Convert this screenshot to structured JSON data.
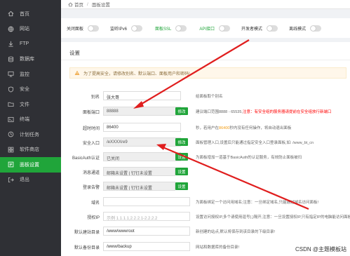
{
  "sidebar": {
    "items": [
      {
        "label": "首页",
        "icon": "home-icon"
      },
      {
        "label": "网站",
        "icon": "globe-icon"
      },
      {
        "label": "FTP",
        "icon": "ftp-icon"
      },
      {
        "label": "数据库",
        "icon": "database-icon"
      },
      {
        "label": "监控",
        "icon": "monitor-icon"
      },
      {
        "label": "安全",
        "icon": "shield-icon"
      },
      {
        "label": "文件",
        "icon": "folder-icon"
      },
      {
        "label": "终端",
        "icon": "terminal-icon"
      },
      {
        "label": "计划任务",
        "icon": "clock-icon"
      },
      {
        "label": "软件商店",
        "icon": "store-icon"
      },
      {
        "label": "面板设置",
        "icon": "settings-icon",
        "active": true
      },
      {
        "label": "退出",
        "icon": "logout-icon"
      }
    ]
  },
  "breadcrumb": {
    "home": "首页",
    "separator": "/",
    "current": "面板设置"
  },
  "switches": [
    {
      "label": "关闭面板",
      "highlight": false
    },
    {
      "label": "监听IPv6",
      "highlight": false
    },
    {
      "label": "面板SSL",
      "highlight": true
    },
    {
      "label": "API接口",
      "highlight": true
    },
    {
      "label": "开发者模式",
      "highlight": false
    },
    {
      "label": "离线模式",
      "highlight": false
    }
  ],
  "settings": {
    "title": "设置",
    "notice": "为了提高安全，请修改别名、默认端口、面板用户和密码!",
    "rows": {
      "alias": {
        "label": "别名",
        "value": "张大哥",
        "hint": "给面板取个别名"
      },
      "port": {
        "label": "面板端口",
        "value": "88888",
        "button": "修改",
        "hint_prefix": "建议端口范围8888 - 65535,",
        "hint_red": "注意：有安全组的服务器请提前在安全组放行新端口"
      },
      "timeout": {
        "label": "超时时间",
        "value": "86400",
        "hint_prefix": "秒，若用户在",
        "hint_orange": "86400",
        "hint_suffix": "秒内没有任何操作，将自动退出面板"
      },
      "entry": {
        "label": "安全入口",
        "value": "/eXXXXre9",
        "button": "修改",
        "hint": "面板管理入口,设置后只能通过指定安全入口登录面板,如: /www_bt_cn"
      },
      "basicauth": {
        "label": "BasicAuth认证",
        "value": "已关闭",
        "button": "设置",
        "hint": "为面板增加一道基于BasicAuth的认证服务，有效防止面板被扫"
      },
      "message": {
        "label": "消息通道",
        "value": "邮箱未设置 | 钉钉未设置",
        "button": "设置"
      },
      "login_alert": {
        "label": "登录告警",
        "value": "邮箱未设置 | 钉钉未设置",
        "button": "设置"
      },
      "domain": {
        "label": "域名",
        "value": "",
        "hint": "为面板绑定一个访问用域名;注意：一旦绑定域名,只能通过域名访问面板!"
      },
      "auth_ip": {
        "label": "授权IP",
        "placeholder": "示例 1.1.1.1,2.2.2.1-2.2.2.2",
        "hint": "设置访问授权IP,多个请使用逗号(,)隔开,注意：一旦设置授权IP,只有指定IP的电脑能访问面板!"
      },
      "site_dir": {
        "label": "默认建站目录",
        "value": "/www/wwwroot",
        "hint": "新创建的站点,默认将保存到该目录的下级目录!"
      },
      "backup_dir": {
        "label": "默认备份目录",
        "value": "/www/backup",
        "hint": "网站和数据库的备份目录!"
      }
    }
  },
  "watermark": "CSDN @主题模板站",
  "colors": {
    "sidebar_bg": "#2f3035",
    "accent": "#20a53a",
    "arrow": "#e01e1e"
  }
}
